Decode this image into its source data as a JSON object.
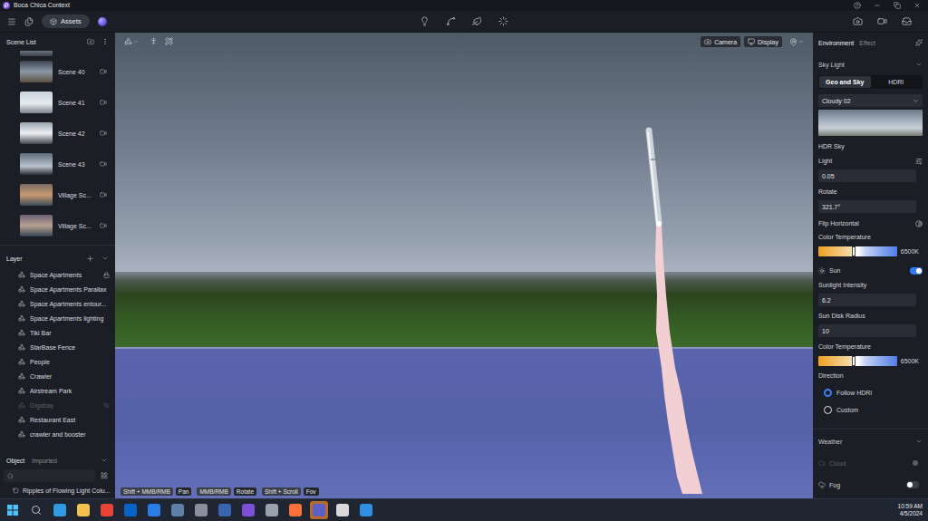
{
  "window": {
    "title": "Boca Chica Context"
  },
  "toolbar": {
    "assets": "Assets"
  },
  "scene_list": {
    "title": "Scene List",
    "items": [
      {
        "label": "Scene 40"
      },
      {
        "label": "Scene 41"
      },
      {
        "label": "Scene 42"
      },
      {
        "label": "Scene 43"
      },
      {
        "label": "Village Sc..."
      },
      {
        "label": "Village Sc..."
      }
    ]
  },
  "layers": {
    "title": "Layer",
    "items": [
      {
        "label": "Space Apartments",
        "locked": true,
        "hidden": false
      },
      {
        "label": "Space Apartments Parallax",
        "locked": false,
        "hidden": false
      },
      {
        "label": "Space Apartments entour...",
        "locked": false,
        "hidden": false
      },
      {
        "label": "Space Apartments lighting",
        "locked": false,
        "hidden": false
      },
      {
        "label": "Tiki Bar",
        "locked": false,
        "hidden": false
      },
      {
        "label": "StarBase Fence",
        "locked": false,
        "hidden": false
      },
      {
        "label": "People",
        "locked": false,
        "hidden": false
      },
      {
        "label": "Crawler",
        "locked": false,
        "hidden": false
      },
      {
        "label": "Airstream Park",
        "locked": false,
        "hidden": false
      },
      {
        "label": "Gigabay",
        "locked": false,
        "hidden": true
      },
      {
        "label": "Restaurant East",
        "locked": false,
        "hidden": false
      },
      {
        "label": "crawler and booster",
        "locked": false,
        "hidden": false
      }
    ]
  },
  "objects": {
    "tabs": [
      {
        "label": "Object",
        "selected": true
      },
      {
        "label": "Imported",
        "selected": false
      }
    ],
    "items": [
      {
        "label": "Ripples of Flowing Light Colu..."
      }
    ]
  },
  "viewport": {
    "buttons": [
      "Camera",
      "Display"
    ],
    "hints": [
      {
        "keys": "Shift + MMB/RMB",
        "action": "Pan"
      },
      {
        "keys": "MMB/RMB",
        "action": "Rotate"
      },
      {
        "keys": "Shift + Scroll",
        "action": "Fov"
      }
    ]
  },
  "environment": {
    "tabs": [
      {
        "label": "Environment",
        "selected": true
      },
      {
        "label": "Effect",
        "selected": false
      }
    ],
    "sky_light": {
      "title": "Sky Light",
      "expanded": true,
      "modes": [
        {
          "label": "Geo and Sky",
          "selected": true
        },
        {
          "label": "HDRI",
          "selected": false
        }
      ],
      "preset": "Cloudy 02",
      "section": "HDR Sky",
      "light": {
        "label": "Light",
        "value": "0.05"
      },
      "rotate": {
        "label": "Rotate",
        "value": "321.7°"
      },
      "flip": {
        "label": "Flip Horizontal"
      },
      "color_temperature": {
        "label": "Color Temperature",
        "level": 0.45,
        "reading": "6500K"
      }
    },
    "sun": {
      "label": "Sun",
      "on": true,
      "intensity": {
        "label": "Sunlight Intensity",
        "value": "6.2"
      },
      "disk_radius": {
        "label": "Sun Disk Radius",
        "value": "10"
      },
      "color_temperature": {
        "label": "Color Temperature",
        "level": 0.45,
        "reading": "6500K"
      },
      "direction": {
        "label": "Direction",
        "options": [
          {
            "label": "Follow HDRI",
            "selected": true
          },
          {
            "label": "Custom",
            "selected": false
          }
        ]
      }
    },
    "weather": {
      "title": "Weather",
      "expanded": true,
      "items": [
        {
          "label": "Cloud",
          "on": false,
          "disabled": true
        },
        {
          "label": "Fog",
          "on": false,
          "disabled": false
        }
      ]
    }
  },
  "taskbar": {
    "apps": [
      {
        "color": "#2f9be0",
        "active": false
      },
      {
        "color": "#f2c14e",
        "active": false
      },
      {
        "color": "#e84335",
        "active": false
      },
      {
        "color": "#0a64c8",
        "active": false
      },
      {
        "color": "#2b7de9",
        "active": false
      },
      {
        "color": "#5f7fa6",
        "active": false
      },
      {
        "color": "#8a8fa0",
        "active": false
      },
      {
        "color": "#3a66b0",
        "active": false
      },
      {
        "color": "#7b4fd6",
        "active": false
      },
      {
        "color": "#9aa3ad",
        "active": false
      },
      {
        "color": "#ff7139",
        "active": false
      },
      {
        "color": "#5b5fc7",
        "active": true
      },
      {
        "color": "#d9d9d9",
        "active": false
      },
      {
        "color": "#2f8fe0",
        "active": false
      }
    ],
    "time": "10:59 AM",
    "date": "4/5/2024"
  }
}
